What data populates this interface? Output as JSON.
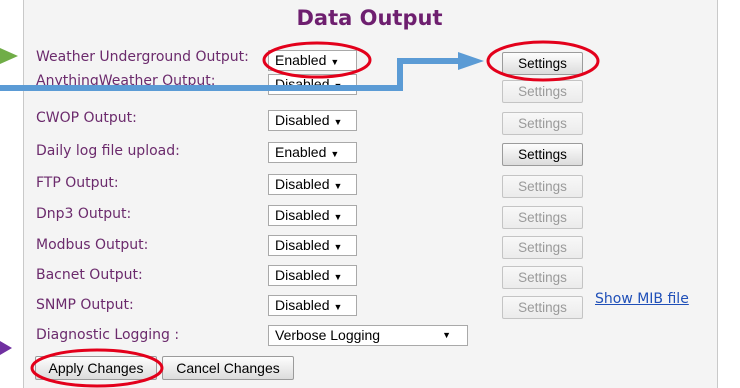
{
  "title": "Data Output",
  "rows": [
    {
      "label": "Weather Underground Output:",
      "value": "Enabled",
      "settings": "Settings",
      "settings_enabled": true
    },
    {
      "label": "AnythingWeather Output:",
      "value": "Disabled",
      "settings": "Settings",
      "settings_enabled": false
    },
    {
      "label": "CWOP Output:",
      "value": "Disabled",
      "settings": "Settings",
      "settings_enabled": false
    },
    {
      "label": "Daily log file upload:",
      "value": "Enabled",
      "settings": "Settings",
      "settings_enabled": true
    },
    {
      "label": "FTP Output:",
      "value": "Disabled",
      "settings": "Settings",
      "settings_enabled": false
    },
    {
      "label": "Dnp3 Output:",
      "value": "Disabled",
      "settings": "Settings",
      "settings_enabled": false
    },
    {
      "label": "Modbus Output:",
      "value": "Disabled",
      "settings": "Settings",
      "settings_enabled": false
    },
    {
      "label": "Bacnet Output:",
      "value": "Disabled",
      "settings": "Settings",
      "settings_enabled": false
    },
    {
      "label": "SNMP Output:",
      "value": "Disabled",
      "settings": "Settings",
      "settings_enabled": false
    }
  ],
  "snmp_link": "Show MIB file",
  "diagnostic": {
    "label": "Diagnostic Logging :",
    "value": "Verbose Logging"
  },
  "buttons": {
    "apply": "Apply Changes",
    "cancel": "Cancel Changes"
  },
  "select_arrow": "▼",
  "colors": {
    "label": "#6b2a6c",
    "title": "#6e1f6f",
    "highlight_circle": "#e3001b",
    "arrow_blue": "#5b9bd5",
    "arrow_green": "#70ad47",
    "arrow_purple": "#7030a0",
    "link": "#1f4fb8"
  }
}
